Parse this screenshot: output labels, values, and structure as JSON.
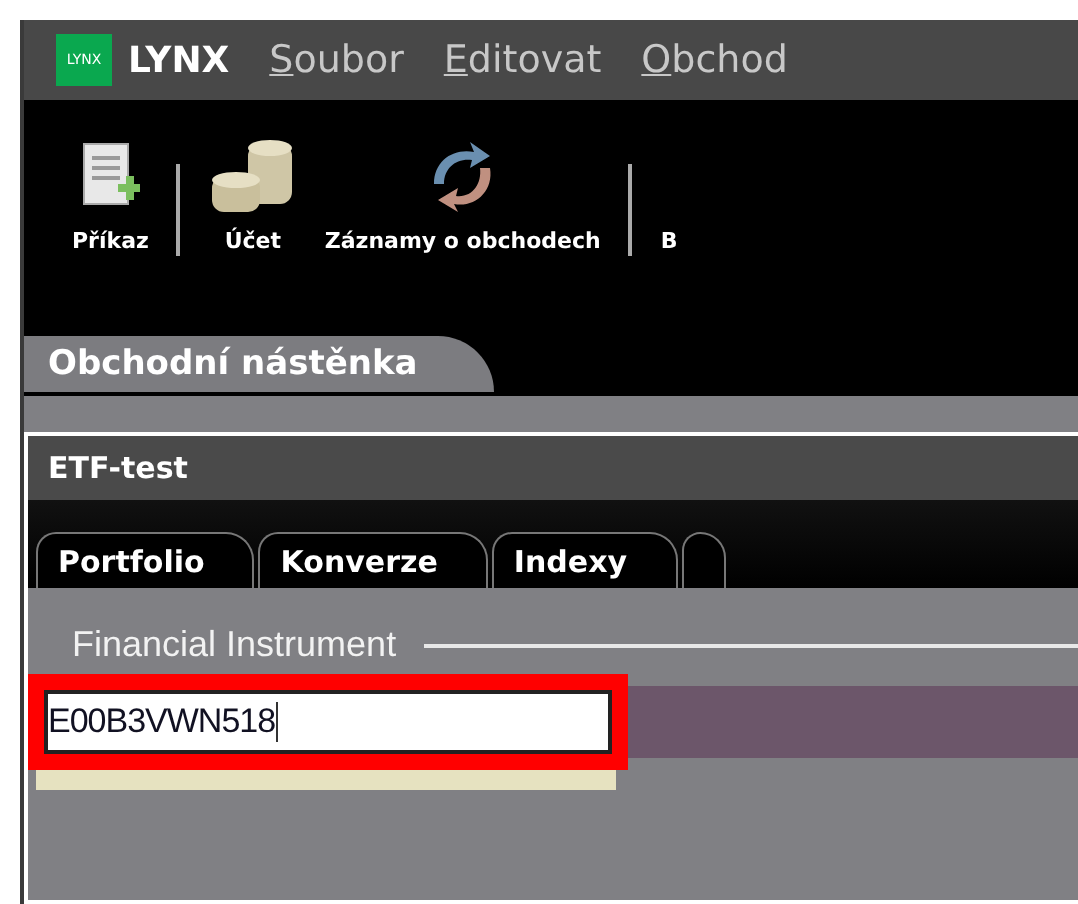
{
  "app": {
    "logo": "LYNX",
    "name": "LYNX"
  },
  "menu": [
    "Soubor",
    "Editovat",
    "Obchod"
  ],
  "toolbar": [
    {
      "label": "Příkaz",
      "kind": "order"
    },
    {
      "label": "Účet",
      "kind": "account"
    },
    {
      "label": "Záznamy o obchodech",
      "kind": "trades"
    },
    {
      "label": "B",
      "kind": "none"
    }
  ],
  "workspace_tab": "Obchodní nástěnka",
  "panel": {
    "title": "ETF-test",
    "tabs": [
      "Portfolio",
      "Konverze",
      "Indexy"
    ],
    "group_label": "Financial Instrument",
    "instrument_field": {
      "value": "E00B3VWN518",
      "highlighted": true
    }
  }
}
